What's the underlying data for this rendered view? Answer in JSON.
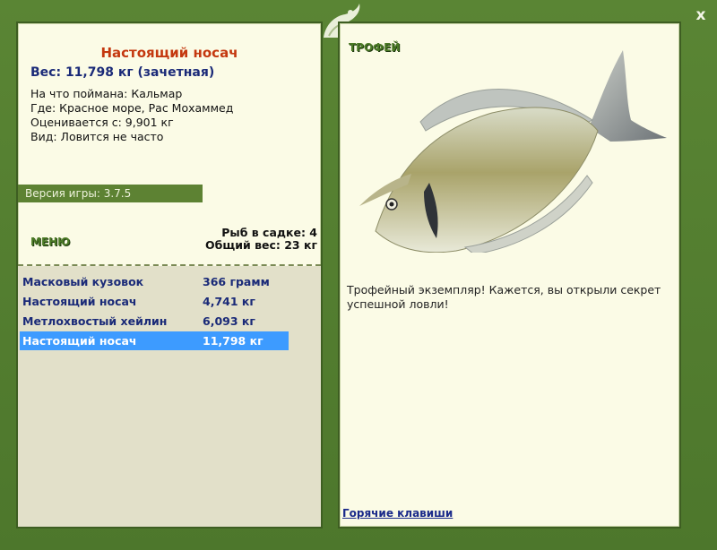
{
  "window": {
    "close_label": "x"
  },
  "fish": {
    "title": "Настоящий носач",
    "weight": "Вес: 11,798 кг (зачетная)",
    "bait_label": "На что поймана:",
    "bait_value": "Кальмар",
    "place_label": "Где:",
    "place_value": "Красное море, Рас Мохаммед",
    "rated_label": "Оценивается с:",
    "rated_value": "9,901 кг",
    "kind_label": "Вид:",
    "kind_value": "Ловится не часто"
  },
  "version": "Версия игры: 3.7.5",
  "menu_label": "МЕНЮ",
  "keepnet": {
    "count_text": "Рыб в садке: 4",
    "total_text": "Общий вес: 23 кг"
  },
  "catch_list": [
    {
      "name": "Масковый кузовок",
      "weight": "366 грамм",
      "selected": false
    },
    {
      "name": "Настоящий носач",
      "weight": "4,741 кг",
      "selected": false
    },
    {
      "name": "Метлохвостый хейлин",
      "weight": "6,093 кг",
      "selected": false
    },
    {
      "name": "Настоящий носач",
      "weight": "11,798 кг",
      "selected": true
    }
  ],
  "trophy": {
    "label": "ТРОФЕЙ",
    "message": "Трофейный экземпляр! Кажется, вы открыли секрет успешной ловли!"
  },
  "hotkeys_label": "Горячие клавиши",
  "colors": {
    "frame": "#4f7a2f",
    "panel": "#fbfbe6",
    "title": "#c4380f",
    "text_blue": "#1a2a78",
    "selected_row": "#3d9bff"
  }
}
